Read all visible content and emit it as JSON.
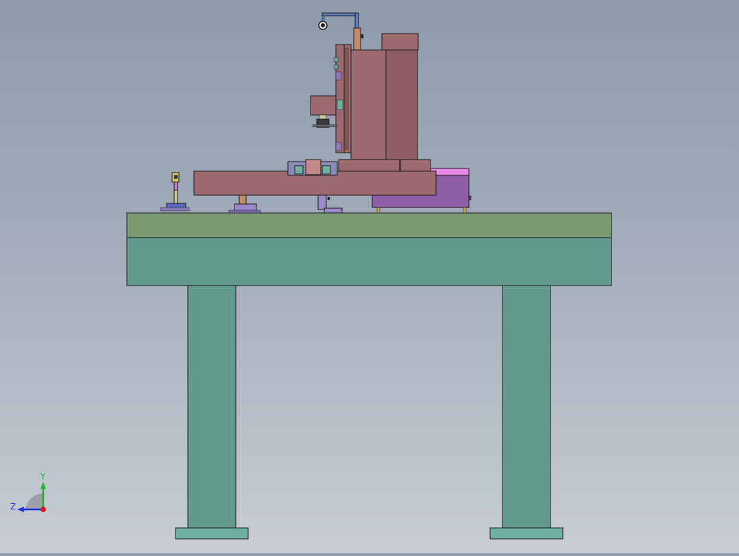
{
  "viewport": {
    "background_top": "#8e9bad",
    "background_bottom": "#c8cdd4"
  },
  "colors": {
    "table_top": "#7a9a72",
    "table_frame": "#629b8e",
    "table_foot": "#6fb0a2",
    "gantry": "#9c6a6f",
    "gantry_dark": "#8a5b60",
    "purple_box": "#8f5fa6",
    "purple_box_top": "#e68ae6",
    "tan_post": "#c48a6a",
    "lavender": "#9a8ac8",
    "blue_tool": "#5f7fc0",
    "outline": "#1a1a1a"
  },
  "triad": {
    "y_label": "Y",
    "z_label": "Z",
    "y_color": "#18b418",
    "z_color": "#1c2fd6",
    "x_color": "#d21c1c"
  }
}
